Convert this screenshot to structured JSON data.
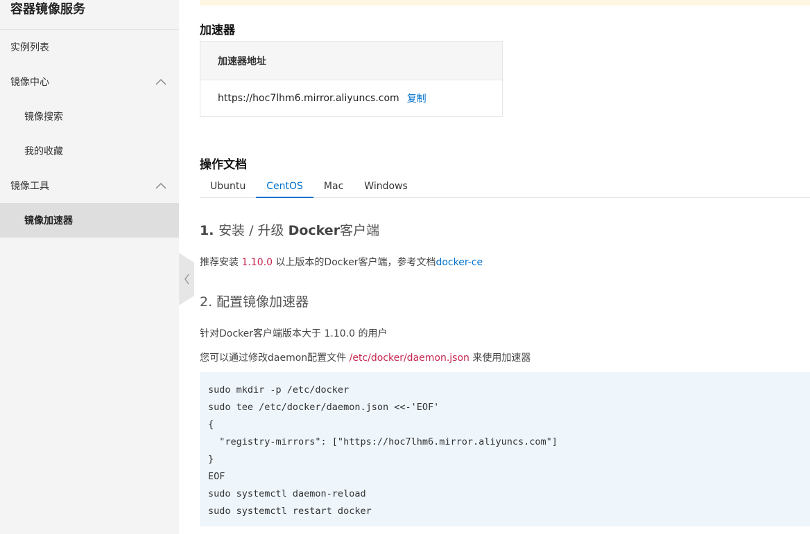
{
  "sidebar": {
    "title": "容器镜像服务",
    "items": [
      {
        "label": "实例列表"
      },
      {
        "label": "镜像中心"
      },
      {
        "label": "镜像搜索"
      },
      {
        "label": "我的收藏"
      },
      {
        "label": "镜像工具"
      },
      {
        "label": "镜像加速器"
      }
    ]
  },
  "accelerator": {
    "title": "加速器",
    "table_header": "加速器地址",
    "address": "https://hoc7lhm6.mirror.aliyuncs.com",
    "copy_label": "复制"
  },
  "docs": {
    "title": "操作文档",
    "tabs": [
      {
        "label": "Ubuntu"
      },
      {
        "label": "CentOS"
      },
      {
        "label": "Mac"
      },
      {
        "label": "Windows"
      }
    ],
    "active_tab": "CentOS",
    "step1": {
      "number": "1. ",
      "title_pre": "安装 / 升级",
      "title_bold": "Docker",
      "title_post": "客户端",
      "text_pre": "推荐安装 ",
      "version": "1.10.0",
      "text_mid": " 以上版本的Docker客户端，参考文档",
      "doc_link": "docker-ce"
    },
    "step2": {
      "title": "2. 配置镜像加速器",
      "text1": "针对Docker客户端版本大于 1.10.0 的用户",
      "text2_pre": "您可以通过修改daemon配置文件 ",
      "config_path": "/etc/docker/daemon.json",
      "text2_post": " 来使用加速器"
    },
    "code_lines": [
      "sudo mkdir -p /etc/docker",
      "sudo tee /etc/docker/daemon.json <<-'EOF'",
      "{",
      "  \"registry-mirrors\": [\"https://hoc7lhm6.mirror.aliyuncs.com\"]",
      "}",
      "EOF",
      "sudo systemctl daemon-reload",
      "sudo systemctl restart docker"
    ]
  },
  "colors": {
    "accent": "#0070cc",
    "highlight": "#c7254e",
    "code_bg": "#eef5fb",
    "sidebar_bg": "#f4f4f4"
  }
}
